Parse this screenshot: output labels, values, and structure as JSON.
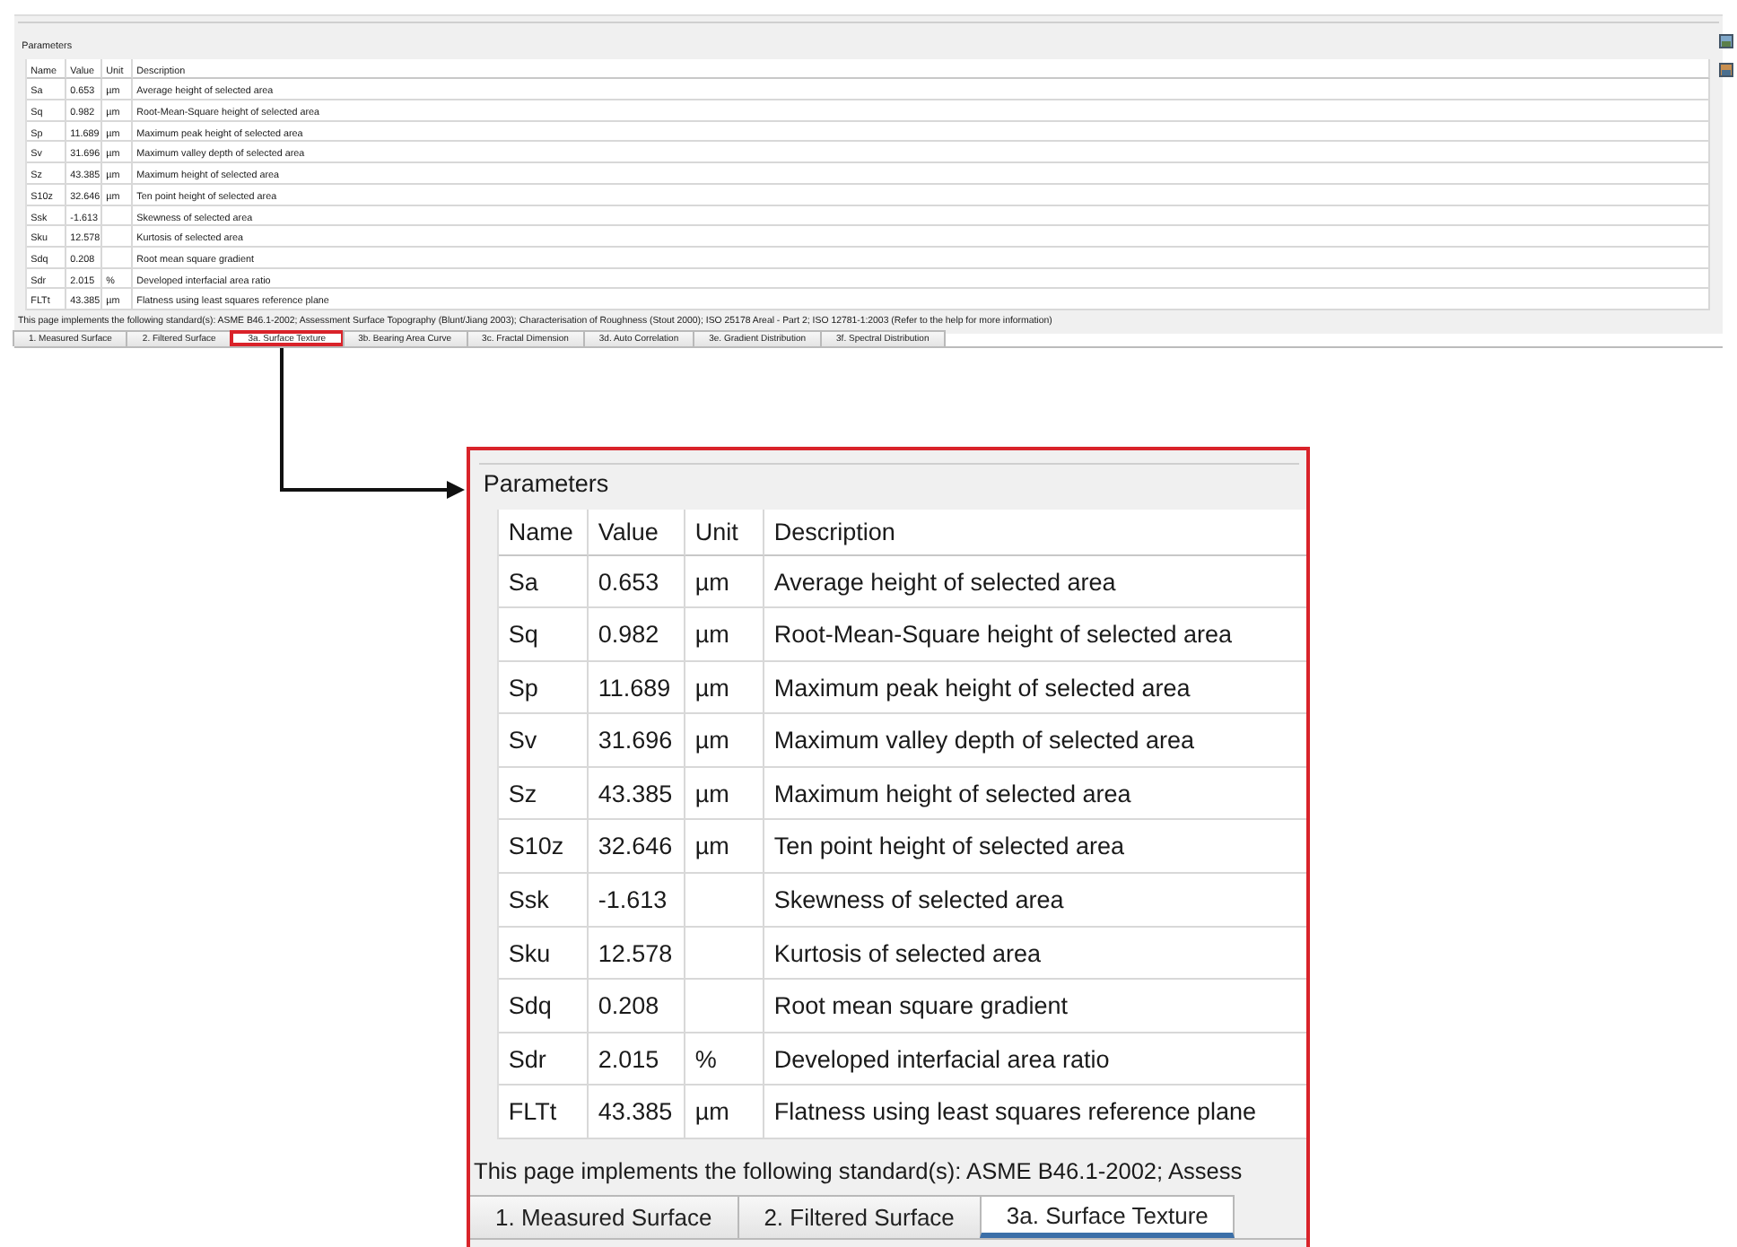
{
  "overview": {
    "group_title": "Parameters",
    "columns": [
      "Name",
      "Value",
      "Unit",
      "Description"
    ],
    "rows": [
      [
        "Sa",
        "0.653",
        "µm",
        "Average height of selected area"
      ],
      [
        "Sq",
        "0.982",
        "µm",
        "Root-Mean-Square height of selected area"
      ],
      [
        "Sp",
        "11.689",
        "µm",
        "Maximum peak height of selected area"
      ],
      [
        "Sv",
        "31.696",
        "µm",
        "Maximum valley depth of selected area"
      ],
      [
        "Sz",
        "43.385",
        "µm",
        "Maximum height of selected area"
      ],
      [
        "S10z",
        "32.646",
        "µm",
        "Ten point height of selected area"
      ],
      [
        "Ssk",
        "-1.613",
        "",
        "Skewness of selected area"
      ],
      [
        "Sku",
        "12.578",
        "",
        "Kurtosis of selected area"
      ],
      [
        "Sdq",
        "0.208",
        "",
        "Root mean square gradient"
      ],
      [
        "Sdr",
        "2.015",
        "%",
        "Developed interfacial area ratio"
      ],
      [
        "FLTt",
        "43.385",
        "µm",
        "Flatness using least squares reference plane"
      ]
    ],
    "footer": "This page implements the following standard(s): ASME B46.1-2002; Assessment Surface Topography (Blunt/Jiang 2003); Characterisation of Roughness (Stout 2000); ISO 25178 Areal - Part 2; ISO 12781-1:2003 (Refer to the help for more information)",
    "tabs": [
      {
        "label": "1. Measured Surface",
        "selected": false
      },
      {
        "label": "2. Filtered Surface",
        "selected": false
      },
      {
        "label": "3a. Surface Texture",
        "selected": true
      },
      {
        "label": "3b. Bearing Area Curve",
        "selected": false
      },
      {
        "label": "3c. Fractal Dimension",
        "selected": false
      },
      {
        "label": "3d. Auto Correlation",
        "selected": false
      },
      {
        "label": "3e. Gradient Distribution",
        "selected": false
      },
      {
        "label": "3f. Spectral Distribution",
        "selected": false
      }
    ]
  },
  "zoom_view": {
    "group_title": "Parameters",
    "columns": [
      "Name",
      "Value",
      "Unit",
      "Description"
    ],
    "rows": [
      [
        "Sa",
        "0.653",
        "µm",
        "Average height of selected area"
      ],
      [
        "Sq",
        "0.982",
        "µm",
        "Root-Mean-Square height of selected area"
      ],
      [
        "Sp",
        "11.689",
        "µm",
        "Maximum peak height of selected area"
      ],
      [
        "Sv",
        "31.696",
        "µm",
        "Maximum valley depth of selected area"
      ],
      [
        "Sz",
        "43.385",
        "µm",
        "Maximum height of selected area"
      ],
      [
        "S10z",
        "32.646",
        "µm",
        "Ten point height of selected area"
      ],
      [
        "Ssk",
        "-1.613",
        "",
        "Skewness of selected area"
      ],
      [
        "Sku",
        "12.578",
        "",
        "Kurtosis of selected area"
      ],
      [
        "Sdq",
        "0.208",
        "",
        "Root mean square gradient"
      ],
      [
        "Sdr",
        "2.015",
        "%",
        "Developed interfacial area ratio"
      ],
      [
        "FLTt",
        "43.385",
        "µm",
        "Flatness using least squares reference plane"
      ]
    ],
    "footer": "This page implements the following standard(s): ASME B46.1-2002; Assess",
    "tabs": [
      {
        "label": "1. Measured Surface",
        "selected": false
      },
      {
        "label": "2. Filtered Surface",
        "selected": false
      },
      {
        "label": "3a. Surface Texture",
        "selected": true
      }
    ]
  }
}
